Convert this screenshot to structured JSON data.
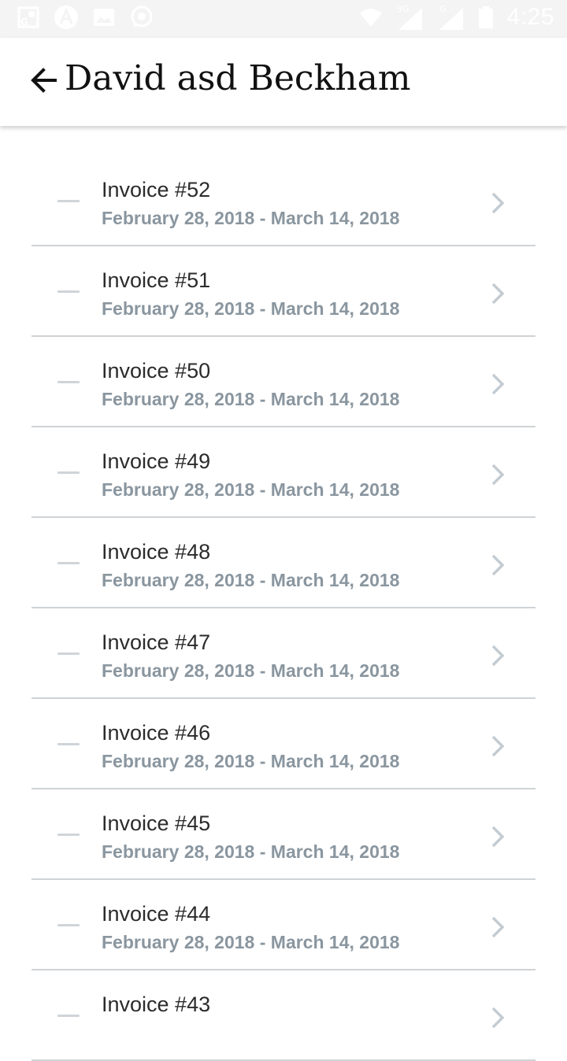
{
  "status_bar": {
    "time": "4:25",
    "network_3g": "3G",
    "network_g": "G",
    "icons": [
      "maps-icon",
      "app-a-icon",
      "image-icon",
      "whatsapp-icon",
      "wifi-icon",
      "signal-3g-icon",
      "signal-g-icon",
      "battery-icon"
    ]
  },
  "header": {
    "back_icon": "arrow-left-icon",
    "title": "David asd Beckham"
  },
  "invoices": [
    {
      "title": "Invoice #52",
      "period": "February 28, 2018 - March 14, 2018"
    },
    {
      "title": "Invoice #51",
      "period": "February 28, 2018 - March 14, 2018"
    },
    {
      "title": "Invoice #50",
      "period": "February 28, 2018 - March 14, 2018"
    },
    {
      "title": "Invoice #49",
      "period": "February 28, 2018 - March 14, 2018"
    },
    {
      "title": "Invoice #48",
      "period": "February 28, 2018 - March 14, 2018"
    },
    {
      "title": "Invoice #47",
      "period": "February 28, 2018 - March 14, 2018"
    },
    {
      "title": "Invoice #46",
      "period": "February 28, 2018 - March 14, 2018"
    },
    {
      "title": "Invoice #45",
      "period": "February 28, 2018 - March 14, 2018"
    },
    {
      "title": "Invoice #44",
      "period": "February 28, 2018 - March 14, 2018"
    },
    {
      "title": "Invoice #43",
      "period": ""
    }
  ],
  "colors": {
    "status_bar_bg": "#f4f4f4",
    "title_text": "#111111",
    "row_title": "#2b2b2b",
    "row_subtitle": "#8a969f",
    "divider": "#cfd3d6",
    "chevron": "#c4ccd2"
  }
}
